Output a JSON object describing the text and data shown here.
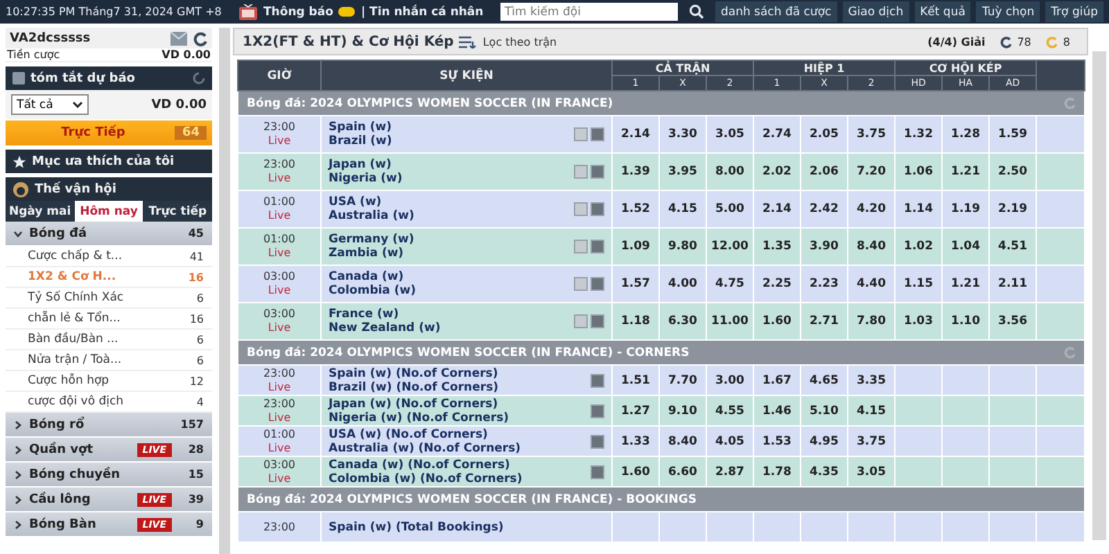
{
  "top_bar": {
    "clock": "10:27:35 PM Tháng7 31, 2024 GMT +8",
    "notices": "Thông báo",
    "messages": "| Tin nhắn cá nhân",
    "search": {
      "placeholder": "Tìm kiếm đội"
    },
    "nav": [
      "danh sách đã cược",
      "Giao dịch",
      "Kết quả",
      "Tuỳ chọn",
      "Trợ giúp"
    ]
  },
  "sidebar": {
    "username": "VA2dcsssss",
    "stake_label": "Tiền cược",
    "stake_value": "VD 0.00",
    "summary_title": "tóm tắt dự báo",
    "filter": "Tất cả",
    "filter_value": "VD 0.00",
    "live_button": {
      "label": "Trực Tiếp",
      "count": "64"
    },
    "favorites": "Mục ưa thích của tôi",
    "event": "Thế vận hội",
    "tabs": [
      {
        "label": "Ngày mai",
        "selected": false
      },
      {
        "label": "Hôm nay",
        "selected": true
      },
      {
        "label": "Trực tiếp",
        "selected": false
      }
    ],
    "sports": [
      {
        "name": "Bóng đá",
        "count": "45",
        "live": false,
        "expanded": true,
        "children": [
          {
            "name": "Cược chấp & t...",
            "count": "41",
            "selected": false
          },
          {
            "name": "1X2 & Cơ H...",
            "count": "16",
            "selected": true
          },
          {
            "name": "Tỷ Số Chính Xác",
            "count": "6",
            "selected": false
          },
          {
            "name": "chẵn lẻ & Tổn...",
            "count": "16",
            "selected": false
          },
          {
            "name": "Bàn đầu/Bàn ...",
            "count": "6",
            "selected": false
          },
          {
            "name": "Nửa trận / Toà...",
            "count": "6",
            "selected": false
          },
          {
            "name": "Cược hỗn hợp",
            "count": "12",
            "selected": false
          },
          {
            "name": "cược đội vô địch",
            "count": "4",
            "selected": false
          }
        ]
      },
      {
        "name": "Bóng rổ",
        "count": "157",
        "live": false,
        "expanded": false
      },
      {
        "name": "Quần vợt",
        "count": "28",
        "live": true,
        "live_label": "LIVE",
        "expanded": false
      },
      {
        "name": "Bóng chuyền",
        "count": "15",
        "live": false,
        "expanded": false
      },
      {
        "name": "Cầu lông",
        "count": "39",
        "live": true,
        "live_label": "LIVE",
        "expanded": false
      },
      {
        "name": "Bóng Bàn",
        "count": "9",
        "live": true,
        "live_label": "LIVE",
        "expanded": false
      }
    ]
  },
  "main": {
    "title": "1X2(FT & HT) & Cơ Hội Kép",
    "filter_link": "Lọc theo trận",
    "leagues": "(4/4) Giải",
    "refresh_count": "78",
    "other_count": "8",
    "table": {
      "columns": [
        "GIỜ",
        "SỰ KIỆN"
      ],
      "groups": [
        {
          "label": "CẢ TRẬN",
          "subs": [
            "1",
            "X",
            "2"
          ]
        },
        {
          "label": "HIỆP 1",
          "subs": [
            "1",
            "X",
            "2"
          ]
        },
        {
          "label": "CƠ HỘI KÉP",
          "subs": [
            "HD",
            "HA",
            "AD"
          ]
        }
      ],
      "sections": [
        {
          "kind": "full",
          "title": "Bóng đá: 2024 OLYMPICS WOMEN SOCCER (IN FRANCE)",
          "rows": [
            {
              "time": "23:00",
              "status": "Live",
              "teams": [
                "Spain (w)",
                "Brazil (w)"
              ],
              "odds": [
                "2.14",
                "3.30",
                "3.05",
                "2.74",
                "2.05",
                "3.75",
                "1.32",
                "1.28",
                "1.59"
              ]
            },
            {
              "time": "23:00",
              "status": "Live",
              "teams": [
                "Japan (w)",
                "Nigeria (w)"
              ],
              "odds": [
                "1.39",
                "3.95",
                "8.00",
                "2.02",
                "2.06",
                "7.20",
                "1.06",
                "1.21",
                "2.50"
              ]
            },
            {
              "time": "01:00",
              "status": "Live",
              "teams": [
                "USA (w)",
                "Australia (w)"
              ],
              "odds": [
                "1.52",
                "4.15",
                "5.00",
                "2.14",
                "2.42",
                "4.20",
                "1.14",
                "1.19",
                "2.19"
              ]
            },
            {
              "time": "01:00",
              "status": "Live",
              "teams": [
                "Germany (w)",
                "Zambia (w)"
              ],
              "odds": [
                "1.09",
                "9.80",
                "12.00",
                "1.35",
                "3.90",
                "8.40",
                "1.02",
                "1.04",
                "4.51"
              ]
            },
            {
              "time": "03:00",
              "status": "Live",
              "teams": [
                "Canada (w)",
                "Colombia (w)"
              ],
              "odds": [
                "1.57",
                "4.00",
                "4.75",
                "2.25",
                "2.23",
                "4.40",
                "1.15",
                "1.21",
                "2.11"
              ]
            },
            {
              "time": "03:00",
              "status": "Live",
              "teams": [
                "France (w)",
                "New Zealand (w)"
              ],
              "odds": [
                "1.18",
                "6.30",
                "11.00",
                "1.60",
                "2.71",
                "7.80",
                "1.03",
                "1.10",
                "3.56"
              ]
            }
          ]
        },
        {
          "kind": "corners",
          "title": "Bóng đá: 2024 OLYMPICS WOMEN SOCCER (IN FRANCE) - CORNERS",
          "rows": [
            {
              "time": "23:00",
              "status": "Live",
              "teams": [
                "Spain (w) (No.of Corners)",
                "Brazil (w) (No.of Corners)"
              ],
              "odds": [
                "1.51",
                "7.70",
                "3.00",
                "1.67",
                "4.65",
                "3.35"
              ]
            },
            {
              "time": "23:00",
              "status": "Live",
              "teams": [
                "Japan (w) (No.of Corners)",
                "Nigeria (w) (No.of Corners)"
              ],
              "odds": [
                "1.27",
                "9.10",
                "4.55",
                "1.46",
                "5.10",
                "4.15"
              ]
            },
            {
              "time": "01:00",
              "status": "Live",
              "teams": [
                "USA (w) (No.of Corners)",
                "Australia (w) (No.of Corners)"
              ],
              "odds": [
                "1.33",
                "8.40",
                "4.05",
                "1.53",
                "4.95",
                "3.75"
              ]
            },
            {
              "time": "03:00",
              "status": "Live",
              "teams": [
                "Canada (w) (No.of Corners)",
                "Colombia (w) (No.of Corners)"
              ],
              "odds": [
                "1.60",
                "6.60",
                "2.87",
                "1.78",
                "4.35",
                "3.05"
              ]
            }
          ]
        },
        {
          "kind": "corners",
          "title": "Bóng đá: 2024 OLYMPICS WOMEN SOCCER (IN FRANCE) - BOOKINGS",
          "rows": [
            {
              "time": "23:00",
              "teams": [
                "Spain (w) (Total Bookings)"
              ],
              "odds": []
            }
          ]
        }
      ]
    }
  }
}
